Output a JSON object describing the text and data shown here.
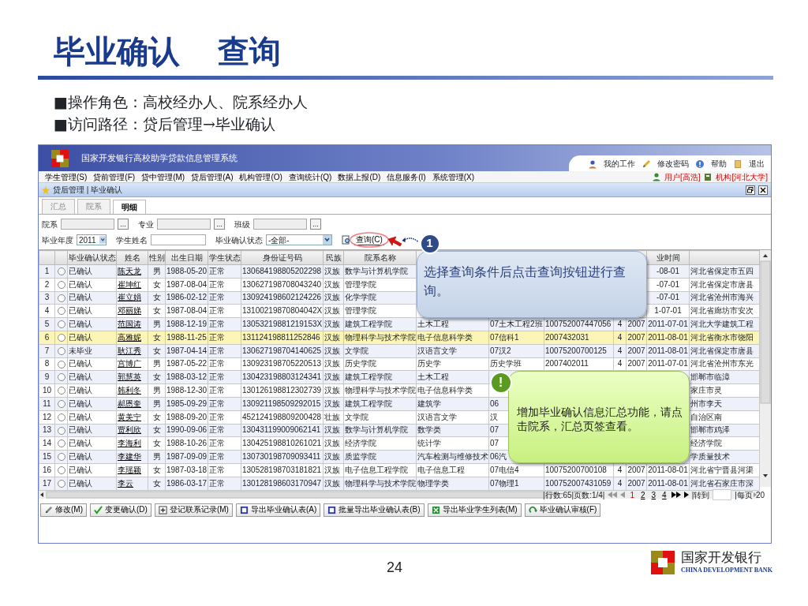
{
  "slide": {
    "title": "毕业确认",
    "subtitle": "查询",
    "bullets": [
      "■操作角色：高校经办人、院系经办人",
      "■访问路径：贷后管理→毕业确认"
    ],
    "page_number": "24",
    "bank_name": "国家开发银行",
    "bank_name_en": "CHINA DEVELOPMENT BANK"
  },
  "app": {
    "title": "国家开发银行高校助学贷款信息管理系统",
    "top_links": [
      "我的工作",
      "修改密码",
      "帮助",
      "退出"
    ],
    "menu": [
      "学生管理(S)",
      "贷前管理(F)",
      "贷中管理(M)",
      "贷后管理(A)",
      "机构管理(O)",
      "查询统计(Q)",
      "数据上报(D)",
      "信息服务(I)",
      "系统管理(X)"
    ],
    "user": "用户[高浩]",
    "org": "机构[河北大学]",
    "breadcrumb": "贷后管理 | 毕业确认",
    "tabs": [
      {
        "label": "汇总",
        "selected": false
      },
      {
        "label": "院系",
        "selected": false
      },
      {
        "label": "明细",
        "selected": true
      }
    ],
    "lookups": [
      {
        "label": "院系",
        "button": "..."
      },
      {
        "label": "专业",
        "button": "..."
      },
      {
        "label": "班级",
        "button": "..."
      }
    ],
    "year": {
      "label": "毕业年度",
      "value": "2011"
    },
    "student_name": {
      "label": "学生姓名"
    },
    "confirm_status": {
      "label": "毕业确认状态",
      "value": "-全部-"
    },
    "search_button": "查询(C)",
    "table": {
      "columns": [
        {
          "kind": "index"
        },
        {
          "kind": "radio"
        },
        {
          "kind": "text",
          "label": "毕业确认状态"
        },
        {
          "kind": "link",
          "label": "姓名"
        },
        {
          "kind": "center",
          "label": "性别"
        },
        {
          "kind": "center",
          "label": "出生日期"
        },
        {
          "kind": "text",
          "label": "学生状态"
        },
        {
          "kind": "text",
          "label": "身份证号码"
        },
        {
          "kind": "text",
          "label": "民族"
        },
        {
          "kind": "text",
          "label": "院系名称"
        },
        {
          "kind": "text"
        },
        {
          "kind": "text"
        },
        {
          "kind": "text"
        },
        {
          "kind": "center"
        },
        {
          "kind": "center"
        },
        {
          "kind": "center",
          "label": "业时间"
        },
        {
          "kind": "text"
        }
      ],
      "rows": [
        {
          "selected": false,
          "checked": false,
          "cells": [
            "1",
            "",
            "已确认",
            "陈天龙",
            "男",
            "1988-05-20",
            "正常",
            "130684198805202298",
            "汉族",
            "数学与计算机学院",
            null,
            null,
            null,
            null,
            null,
            "-08-01",
            "河北省保定市五四"
          ]
        },
        {
          "selected": false,
          "checked": false,
          "cells": [
            "2",
            "",
            "已确认",
            "崔坤红",
            "女",
            "1987-08-04",
            "正常",
            "130627198708043240",
            "汉族",
            "管理学院",
            null,
            null,
            null,
            null,
            null,
            "-07-01",
            "河北省保定市唐县"
          ]
        },
        {
          "selected": false,
          "checked": false,
          "cells": [
            "3",
            "",
            "已确认",
            "崔立娟",
            "女",
            "1986-02-12",
            "正常",
            "130924198602124226",
            "汉族",
            "化学学院",
            null,
            null,
            null,
            null,
            null,
            "-07-01",
            "河北省沧州市海兴"
          ]
        },
        {
          "selected": false,
          "checked": false,
          "cells": [
            "4",
            "",
            "已确认",
            "邓丽娣",
            "女",
            "1987-08-04",
            "正常",
            "13100219870804042X",
            "汉族",
            "管理学院",
            null,
            null,
            null,
            null,
            null,
            "1-07-01",
            "河北省廊坊市安次"
          ]
        },
        {
          "selected": false,
          "checked": false,
          "cells": [
            "5",
            "",
            "已确认",
            "范国涛",
            "男",
            "1988-12-19",
            "正常",
            "13053219881219153X",
            "汉族",
            "建筑工程学院",
            "土木工程",
            "07土木工程2班",
            "100752007447056",
            "4",
            "2007",
            "2011-07-01",
            "河北大学建筑工程"
          ]
        },
        {
          "selected": true,
          "checked": false,
          "cells": [
            "6",
            "",
            "已确认",
            "高雅妮",
            "女",
            "1988-11-25",
            "正常",
            "131124198811252846",
            "汉族",
            "物理科学与技术学院",
            "电子信息科学类",
            "07信科1",
            "2007432031",
            "4",
            "2007",
            "2011-08-01",
            "河北省衡水市饶阳"
          ]
        },
        {
          "selected": false,
          "checked": false,
          "cells": [
            "7",
            "",
            "未毕业",
            "耿江秀",
            "女",
            "1987-04-14",
            "正常",
            "130627198704140625",
            "汉族",
            "文学院",
            "汉语言文学",
            "07汉2",
            "10075200700125",
            "4",
            "2007",
            "2011-08-01",
            "河北省保定市唐县"
          ]
        },
        {
          "selected": false,
          "checked": false,
          "cells": [
            "8",
            "",
            "已确认",
            "宫博广",
            "男",
            "1987-05-22",
            "正常",
            "130923198705220513",
            "汉族",
            "历史学院",
            "历史学",
            "历史学班",
            "2007402011",
            "4",
            "2007",
            "2011-07-01",
            "河北省沧州市东光"
          ]
        },
        {
          "selected": false,
          "checked": false,
          "cells": [
            "9",
            "",
            "已确认",
            "郭慧英",
            "女",
            "1988-03-12",
            "正常",
            "130423198803124341",
            "汉族",
            "建筑工程学院",
            "土木工程",
            null,
            null,
            null,
            null,
            null,
            "邯郸市临漳"
          ]
        },
        {
          "selected": false,
          "checked": false,
          "cells": [
            "10",
            "",
            "已确认",
            "韩利冬",
            "男",
            "1988-12-30",
            "正常",
            "130126198812302739",
            "汉族",
            "物理科学与技术学院",
            "电子信息科学类",
            null,
            null,
            null,
            null,
            null,
            "家庄市灵"
          ]
        },
        {
          "selected": false,
          "checked": false,
          "cells": [
            "11",
            "",
            "已确认",
            "郝恩奎",
            "男",
            "1985-09-29",
            "正常",
            "130921198509292015",
            "汉族",
            "建筑工程学院",
            "建筑学",
            "06",
            null,
            null,
            null,
            null,
            "州市李天"
          ]
        },
        {
          "selected": false,
          "checked": false,
          "cells": [
            "12",
            "",
            "已确认",
            "黄美宁",
            "女",
            "1988-09-20",
            "正常",
            "452124198809200428",
            "壮族",
            "文学院",
            "汉语言文学",
            "汉",
            null,
            null,
            null,
            null,
            "自治区南"
          ]
        },
        {
          "selected": false,
          "checked": false,
          "cells": [
            "13",
            "",
            "已确认",
            "贾利欣",
            "女",
            "1990-09-06",
            "正常",
            "130431199009062141",
            "汉族",
            "数学与计算机学院",
            "数学类",
            "07",
            null,
            null,
            null,
            null,
            "邯郸市鸡泽"
          ]
        },
        {
          "selected": false,
          "checked": false,
          "cells": [
            "14",
            "",
            "已确认",
            "李海利",
            "女",
            "1988-10-26",
            "正常",
            "130425198810261021",
            "汉族",
            "经济学院",
            "统计学",
            "07",
            null,
            null,
            null,
            null,
            "经济学院"
          ]
        },
        {
          "selected": false,
          "checked": false,
          "cells": [
            "15",
            "",
            "已确认",
            "李建华",
            "男",
            "1987-09-09",
            "正常",
            "130730198709093411",
            "汉族",
            "质监学院",
            "汽车检测与维修技术",
            "06汽",
            null,
            null,
            null,
            null,
            "学质量技术"
          ]
        },
        {
          "selected": false,
          "checked": false,
          "cells": [
            "16",
            "",
            "已确认",
            "李瑶颖",
            "女",
            "1987-03-18",
            "正常",
            "130528198703181821",
            "汉族",
            "电子信息工程学院",
            "电子信息工程",
            "07电信4",
            "10075200700108",
            "4",
            "2007",
            "2011-08-01",
            "河北省宁晋县河渠"
          ]
        },
        {
          "selected": false,
          "checked": false,
          "cells": [
            "17",
            "",
            "已确认",
            "李云",
            "女",
            "1986-03-17",
            "正常",
            "130128198603170947",
            "汉族",
            "物理科学与技术学院",
            "物理学类",
            "07物理1",
            "100752007431059",
            "4",
            "2007",
            "2011-08-01",
            "河北省石家庄市深"
          ]
        }
      ]
    },
    "pager": {
      "info": "|行数:65|页数:1/4|",
      "pages": [
        {
          "label": "1",
          "selected": true
        },
        {
          "label": "2",
          "selected": false
        },
        {
          "label": "3",
          "selected": false
        },
        {
          "label": "4",
          "selected": false
        }
      ],
      "goto": "|转到",
      "per_page": "|每页",
      "per_page_value": "20"
    },
    "buttons": [
      "修改(M)",
      "变更确认(D)",
      "登记联系记录(M)",
      "导出毕业确认表(A)",
      "批量导出毕业确认表(B)",
      "导出毕业学生列表(M)",
      "毕业确认审核(F)"
    ]
  },
  "callouts": [
    {
      "kind": "info",
      "badge": "1",
      "text": "选择查询条件后点击查询按钮进行查询。"
    },
    {
      "kind": "notice",
      "badge": "!",
      "text": "增加毕业确认信息汇总功能，请点击院系，汇总页签查看。"
    }
  ]
}
